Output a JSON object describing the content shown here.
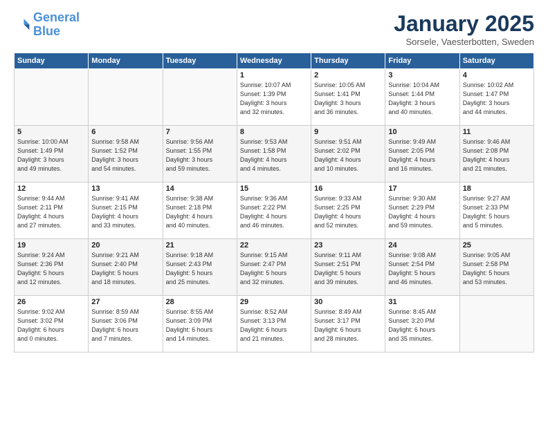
{
  "logo": {
    "line1": "General",
    "line2": "Blue"
  },
  "title": "January 2025",
  "subtitle": "Sorsele, Vaesterbotten, Sweden",
  "days_header": [
    "Sunday",
    "Monday",
    "Tuesday",
    "Wednesday",
    "Thursday",
    "Friday",
    "Saturday"
  ],
  "weeks": [
    [
      {
        "day": "",
        "info": ""
      },
      {
        "day": "",
        "info": ""
      },
      {
        "day": "",
        "info": ""
      },
      {
        "day": "1",
        "info": "Sunrise: 10:07 AM\nSunset: 1:39 PM\nDaylight: 3 hours\nand 32 minutes."
      },
      {
        "day": "2",
        "info": "Sunrise: 10:05 AM\nSunset: 1:41 PM\nDaylight: 3 hours\nand 36 minutes."
      },
      {
        "day": "3",
        "info": "Sunrise: 10:04 AM\nSunset: 1:44 PM\nDaylight: 3 hours\nand 40 minutes."
      },
      {
        "day": "4",
        "info": "Sunrise: 10:02 AM\nSunset: 1:47 PM\nDaylight: 3 hours\nand 44 minutes."
      }
    ],
    [
      {
        "day": "5",
        "info": "Sunrise: 10:00 AM\nSunset: 1:49 PM\nDaylight: 3 hours\nand 49 minutes."
      },
      {
        "day": "6",
        "info": "Sunrise: 9:58 AM\nSunset: 1:52 PM\nDaylight: 3 hours\nand 54 minutes."
      },
      {
        "day": "7",
        "info": "Sunrise: 9:56 AM\nSunset: 1:55 PM\nDaylight: 3 hours\nand 59 minutes."
      },
      {
        "day": "8",
        "info": "Sunrise: 9:53 AM\nSunset: 1:58 PM\nDaylight: 4 hours\nand 4 minutes."
      },
      {
        "day": "9",
        "info": "Sunrise: 9:51 AM\nSunset: 2:02 PM\nDaylight: 4 hours\nand 10 minutes."
      },
      {
        "day": "10",
        "info": "Sunrise: 9:49 AM\nSunset: 2:05 PM\nDaylight: 4 hours\nand 16 minutes."
      },
      {
        "day": "11",
        "info": "Sunrise: 9:46 AM\nSunset: 2:08 PM\nDaylight: 4 hours\nand 21 minutes."
      }
    ],
    [
      {
        "day": "12",
        "info": "Sunrise: 9:44 AM\nSunset: 2:11 PM\nDaylight: 4 hours\nand 27 minutes."
      },
      {
        "day": "13",
        "info": "Sunrise: 9:41 AM\nSunset: 2:15 PM\nDaylight: 4 hours\nand 33 minutes."
      },
      {
        "day": "14",
        "info": "Sunrise: 9:38 AM\nSunset: 2:18 PM\nDaylight: 4 hours\nand 40 minutes."
      },
      {
        "day": "15",
        "info": "Sunrise: 9:36 AM\nSunset: 2:22 PM\nDaylight: 4 hours\nand 46 minutes."
      },
      {
        "day": "16",
        "info": "Sunrise: 9:33 AM\nSunset: 2:25 PM\nDaylight: 4 hours\nand 52 minutes."
      },
      {
        "day": "17",
        "info": "Sunrise: 9:30 AM\nSunset: 2:29 PM\nDaylight: 4 hours\nand 59 minutes."
      },
      {
        "day": "18",
        "info": "Sunrise: 9:27 AM\nSunset: 2:33 PM\nDaylight: 5 hours\nand 5 minutes."
      }
    ],
    [
      {
        "day": "19",
        "info": "Sunrise: 9:24 AM\nSunset: 2:36 PM\nDaylight: 5 hours\nand 12 minutes."
      },
      {
        "day": "20",
        "info": "Sunrise: 9:21 AM\nSunset: 2:40 PM\nDaylight: 5 hours\nand 18 minutes."
      },
      {
        "day": "21",
        "info": "Sunrise: 9:18 AM\nSunset: 2:43 PM\nDaylight: 5 hours\nand 25 minutes."
      },
      {
        "day": "22",
        "info": "Sunrise: 9:15 AM\nSunset: 2:47 PM\nDaylight: 5 hours\nand 32 minutes."
      },
      {
        "day": "23",
        "info": "Sunrise: 9:11 AM\nSunset: 2:51 PM\nDaylight: 5 hours\nand 39 minutes."
      },
      {
        "day": "24",
        "info": "Sunrise: 9:08 AM\nSunset: 2:54 PM\nDaylight: 5 hours\nand 46 minutes."
      },
      {
        "day": "25",
        "info": "Sunrise: 9:05 AM\nSunset: 2:58 PM\nDaylight: 5 hours\nand 53 minutes."
      }
    ],
    [
      {
        "day": "26",
        "info": "Sunrise: 9:02 AM\nSunset: 3:02 PM\nDaylight: 6 hours\nand 0 minutes."
      },
      {
        "day": "27",
        "info": "Sunrise: 8:59 AM\nSunset: 3:06 PM\nDaylight: 6 hours\nand 7 minutes."
      },
      {
        "day": "28",
        "info": "Sunrise: 8:55 AM\nSunset: 3:09 PM\nDaylight: 6 hours\nand 14 minutes."
      },
      {
        "day": "29",
        "info": "Sunrise: 8:52 AM\nSunset: 3:13 PM\nDaylight: 6 hours\nand 21 minutes."
      },
      {
        "day": "30",
        "info": "Sunrise: 8:49 AM\nSunset: 3:17 PM\nDaylight: 6 hours\nand 28 minutes."
      },
      {
        "day": "31",
        "info": "Sunrise: 8:45 AM\nSunset: 3:20 PM\nDaylight: 6 hours\nand 35 minutes."
      },
      {
        "day": "",
        "info": ""
      }
    ]
  ]
}
